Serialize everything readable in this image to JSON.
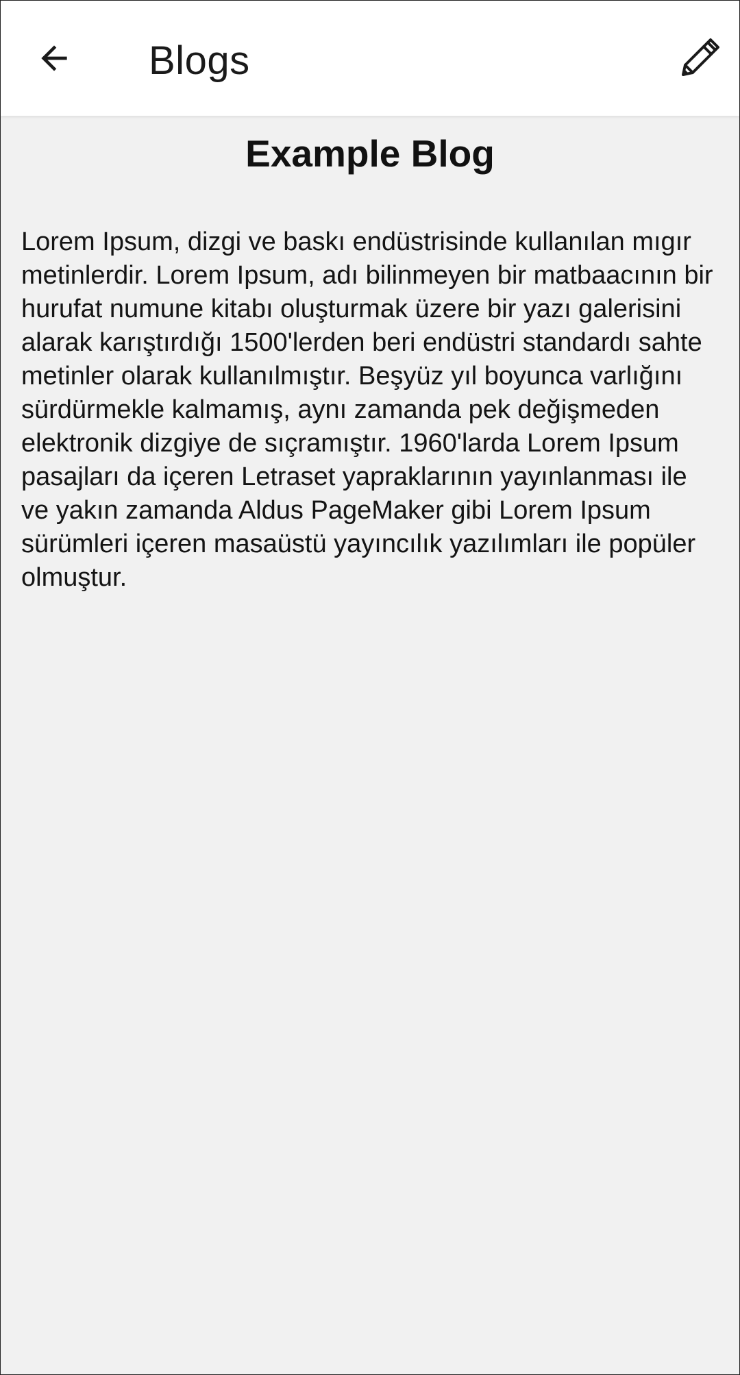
{
  "app_bar": {
    "title": "Blogs",
    "back_icon": "arrow-back-icon",
    "edit_icon": "pencil-icon"
  },
  "blog": {
    "title": "Example Blog",
    "body": "Lorem Ipsum, dizgi ve baskı endüstrisinde kullanılan mıgır metinlerdir. Lorem Ipsum, adı bilinmeyen bir matbaacının bir hurufat numune kitabı oluşturmak üzere bir yazı galerisini alarak karıştırdığı 1500'lerden beri endüstri standardı sahte metinler olarak kullanılmıştır. Beşyüz yıl boyunca varlığını sürdürmekle kalmamış, aynı zamanda pek değişmeden elektronik dizgiye de sıçramıştır. 1960'larda Lorem Ipsum pasajları da içeren Letraset yapraklarının yayınlanması ile ve yakın zamanda Aldus PageMaker gibi Lorem Ipsum sürümleri içeren masaüstü yayıncılık yazılımları ile popüler olmuştur."
  },
  "colors": {
    "app_bar_background": "#ffffff",
    "page_background": "#f1f1f1",
    "text": "#111111"
  }
}
